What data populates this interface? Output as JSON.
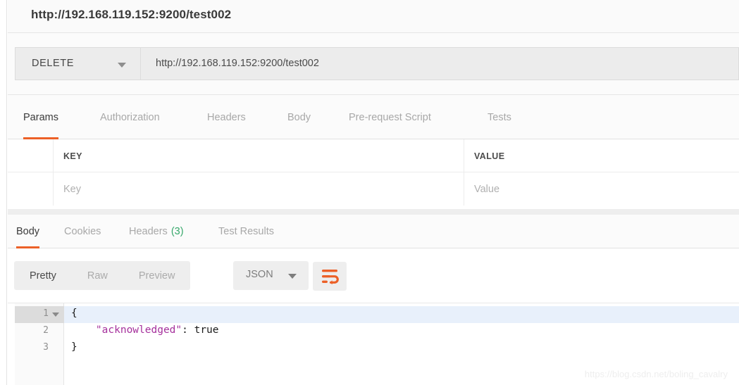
{
  "window": {
    "title": "http://192.168.119.152:9200/test002"
  },
  "request": {
    "method": "DELETE",
    "url": "http://192.168.119.152:9200/test002",
    "tabs": [
      {
        "label": "Params",
        "active": true
      },
      {
        "label": "Authorization",
        "active": false
      },
      {
        "label": "Headers",
        "active": false
      },
      {
        "label": "Body",
        "active": false
      },
      {
        "label": "Pre-request Script",
        "active": false
      },
      {
        "label": "Tests",
        "active": false
      }
    ],
    "params_table": {
      "headers": {
        "key": "KEY",
        "value": "VALUE"
      },
      "rows": [
        {
          "key_placeholder": "Key",
          "value_placeholder": "Value"
        }
      ]
    }
  },
  "response": {
    "tabs": [
      {
        "label": "Body",
        "count": "",
        "active": true
      },
      {
        "label": "Cookies",
        "count": "",
        "active": false
      },
      {
        "label": "Headers",
        "count": "(3)",
        "active": false
      },
      {
        "label": "Test Results",
        "count": "",
        "active": false
      }
    ],
    "format_modes": [
      {
        "label": "Pretty",
        "active": true
      },
      {
        "label": "Raw",
        "active": false
      },
      {
        "label": "Preview",
        "active": false
      }
    ],
    "language": "JSON",
    "wrap_icon": "word-wrap-icon",
    "body": {
      "lines": [
        {
          "num": "1",
          "foldable": true,
          "highlighted": true,
          "raw": "{"
        },
        {
          "num": "2",
          "foldable": false,
          "highlighted": false,
          "key": "\"acknowledged\"",
          "rest": ": true"
        },
        {
          "num": "3",
          "foldable": false,
          "highlighted": false,
          "raw": "}"
        }
      ]
    }
  },
  "watermark": "https://blog.csdn.net/boling_cavalry",
  "colors": {
    "accent": "#ec6027",
    "count": "#37a86b",
    "json_key": "#a5309c",
    "highlight_row": "#e8f0fb"
  }
}
